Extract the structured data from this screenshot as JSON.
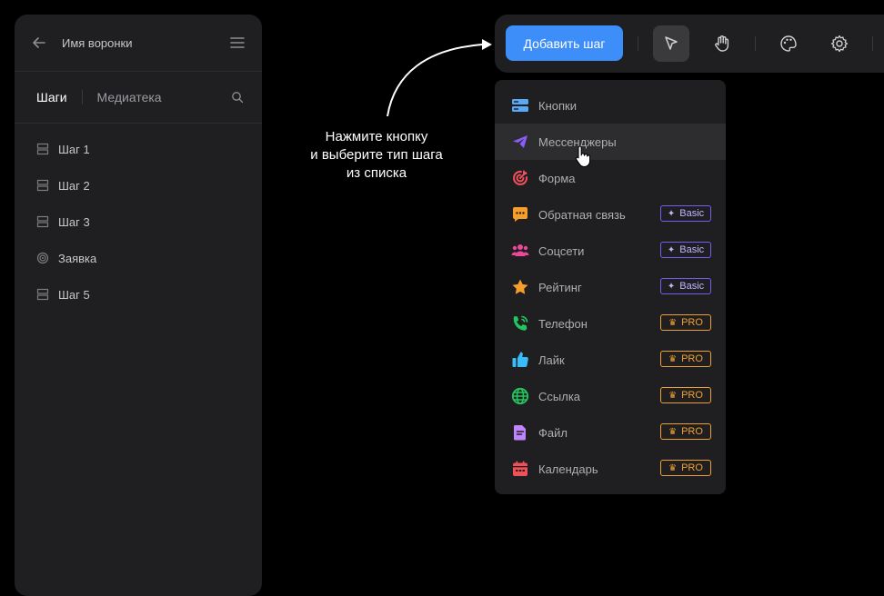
{
  "sidebar": {
    "title": "Имя воронки",
    "tabs": {
      "active": "Шаги",
      "other": "Медиатека"
    },
    "steps": [
      {
        "label": "Шаг 1",
        "icon": "rows-icon"
      },
      {
        "label": "Шаг 2",
        "icon": "rows-icon"
      },
      {
        "label": "Шаг 3",
        "icon": "rows-icon"
      },
      {
        "label": "Заявка",
        "icon": "target-icon"
      },
      {
        "label": "Шаг 5",
        "icon": "rows-icon"
      }
    ]
  },
  "toolbar": {
    "add_label": "Добавить шаг",
    "tools": [
      "cursor-icon",
      "hand-icon",
      "palette-icon",
      "gear-icon"
    ]
  },
  "hint": {
    "lines": [
      "Нажмите кнопку",
      "и выберите тип шага",
      "из списка"
    ]
  },
  "menu": {
    "items": [
      {
        "label": "Кнопки",
        "icon": "buttons-icon",
        "color": "#5aa9f5"
      },
      {
        "label": "Мессенджеры",
        "icon": "send-icon",
        "color": "#8b5cf6"
      },
      {
        "label": "Форма",
        "icon": "form-target-icon",
        "color": "#f0505a"
      },
      {
        "label": "Обратная связь",
        "icon": "chat-icon",
        "color": "#f59e2b",
        "badge": "Basic"
      },
      {
        "label": "Соцсети",
        "icon": "people-icon",
        "color": "#ec4899",
        "badge": "Basic"
      },
      {
        "label": "Рейтинг",
        "icon": "star-icon",
        "color": "#f59e2b",
        "badge": "Basic"
      },
      {
        "label": "Телефон",
        "icon": "phone-icon",
        "color": "#22c55e",
        "badge": "PRO"
      },
      {
        "label": "Лайк",
        "icon": "like-icon",
        "color": "#38bdf8",
        "badge": "PRO"
      },
      {
        "label": "Ссылка",
        "icon": "globe-icon",
        "color": "#22c55e",
        "badge": "PRO"
      },
      {
        "label": "Файл",
        "icon": "file-icon",
        "color": "#c084fc",
        "badge": "PRO"
      },
      {
        "label": "Календарь",
        "icon": "calendar-icon",
        "color": "#f0505a",
        "badge": "PRO"
      }
    ],
    "hovered_index": 1
  }
}
